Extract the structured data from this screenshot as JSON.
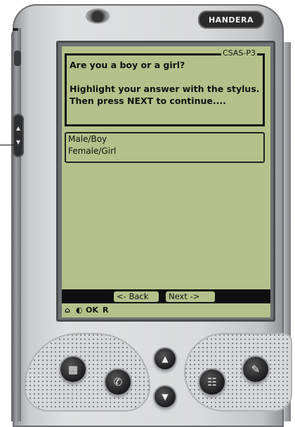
{
  "device": {
    "brand": "HANDERA"
  },
  "screen": {
    "form_id": "CSAS-P3",
    "question": "Are you a boy or a girl?\n\nHighlight your answer with the stylus. Then press NEXT to continue....",
    "answers": [
      "Male/Boy",
      "Female/Girl"
    ],
    "nav": {
      "back_label": "<- Back",
      "next_label": "Next ->"
    },
    "status": {
      "home_icon": "⌂",
      "contrast_icon": "◐",
      "ok_label": "OK",
      "r_label": "R"
    }
  },
  "hardware_buttons": {
    "date_icon": "▦",
    "phone_icon": "✆",
    "up_icon": "▲",
    "down_icon": "▼",
    "todo_icon": "☷",
    "memo_icon": "✎"
  }
}
